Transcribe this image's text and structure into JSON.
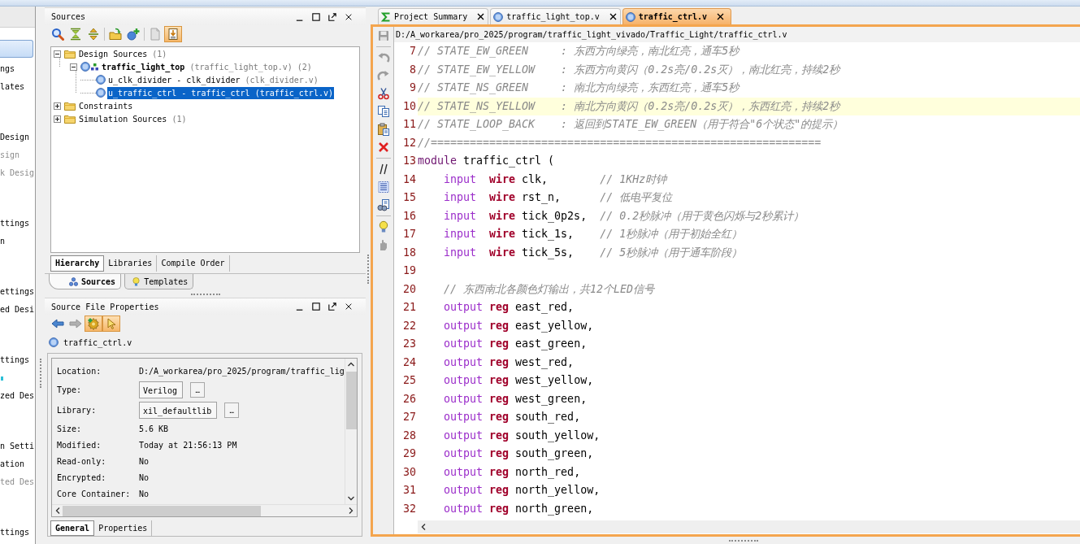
{
  "flow_navigator": {
    "sections": [
      {
        "selected": true,
        "items": [
          {
            "kind": "text",
            "label": "ngs",
            "disabled": false
          },
          {
            "kind": "text",
            "label": "lates",
            "disabled": false
          }
        ]
      },
      {
        "selected": false,
        "items": [
          {
            "kind": "text",
            "label": "Design",
            "disabled": false
          },
          {
            "kind": "text",
            "label": "sign",
            "disabled": true
          },
          {
            "kind": "text",
            "label": "k Desig",
            "disabled": true
          }
        ]
      },
      {
        "selected": false,
        "items": [
          {
            "kind": "text",
            "label": "ttings",
            "disabled": false
          },
          {
            "kind": "text",
            "label": "n",
            "disabled": false
          }
        ]
      },
      {
        "selected": false,
        "items": [
          {
            "kind": "text",
            "label": "ettings",
            "disabled": false
          },
          {
            "kind": "text",
            "label": "ed Desi",
            "disabled": false
          }
        ]
      },
      {
        "selected": false,
        "items": [
          {
            "kind": "text",
            "label": "ttings",
            "disabled": false
          },
          {
            "kind": "icon",
            "disabled": false
          },
          {
            "kind": "text",
            "label": "zed Des",
            "disabled": false
          }
        ]
      },
      {
        "selected": false,
        "items": [
          {
            "kind": "text",
            "label": "n Setti",
            "disabled": false
          },
          {
            "kind": "text",
            "label": "ation",
            "disabled": false
          },
          {
            "kind": "text",
            "label": "ted Des",
            "disabled": true
          }
        ]
      },
      {
        "selected": false,
        "items": [
          {
            "kind": "text",
            "label": "ttings",
            "disabled": false
          }
        ]
      }
    ]
  },
  "sources_panel": {
    "title": "Sources",
    "toolbar": [
      {
        "buttons": [
          {
            "kind": "search",
            "disabled": false,
            "pressed": false
          },
          {
            "kind": "collapse_all",
            "disabled": false,
            "pressed": false
          },
          {
            "kind": "expand_all",
            "disabled": false,
            "pressed": false
          }
        ]
      },
      {
        "buttons": [
          {
            "kind": "add_folder",
            "disabled": false,
            "pressed": false
          },
          {
            "kind": "add_source",
            "disabled": false,
            "pressed": false
          }
        ]
      },
      {
        "buttons": [
          {
            "kind": "help",
            "disabled": true,
            "pressed": false
          },
          {
            "kind": "source_view",
            "disabled": false,
            "pressed": true
          }
        ]
      }
    ],
    "tree": [
      {
        "kind": "folder",
        "label": "Design Sources",
        "detail": "(1)",
        "expanded": true,
        "selected": false,
        "children": [
          {
            "kind": "top_module",
            "label": "traffic_light_top",
            "detail": "(traffic_light_top.v) (2)",
            "expanded": true,
            "selected": false,
            "children": [
              {
                "kind": "instance",
                "label": "u_clk_divider - clk_divider",
                "detail": "(clk_divider.v)",
                "selected": false
              },
              {
                "kind": "instance",
                "label": "u_traffic_ctrl - traffic_ctrl",
                "detail": "(traffic_ctrl.v)",
                "selected": true
              }
            ]
          }
        ]
      },
      {
        "kind": "folder",
        "label": "Constraints",
        "expanded": false,
        "selected": false
      },
      {
        "kind": "folder",
        "label": "Simulation Sources",
        "detail": "(1)",
        "expanded": false,
        "selected": false
      }
    ],
    "view_tabs": [
      {
        "label": "Hierarchy",
        "selected": true
      },
      {
        "label": "Libraries",
        "selected": false
      },
      {
        "label": "Compile Order",
        "selected": false
      }
    ],
    "bottom_tabs": [
      {
        "kind": "sources",
        "label": "Sources",
        "selected": true
      },
      {
        "kind": "templates",
        "label": "Templates",
        "selected": false
      }
    ]
  },
  "properties_panel": {
    "title": "Source File Properties",
    "toolbar": [
      {
        "buttons": [
          {
            "kind": "back",
            "disabled": false,
            "pressed": false
          },
          {
            "kind": "forward",
            "disabled": true,
            "pressed": false
          },
          {
            "kind": "settings",
            "disabled": false,
            "pressed": true
          },
          {
            "kind": "select",
            "disabled": false,
            "pressed": true
          }
        ]
      }
    ],
    "file": "traffic_ctrl.v",
    "rows": [
      {
        "kind": "text",
        "label": "Location:",
        "value": "D:/A_workarea/pro_2025/program/traffic_lig"
      },
      {
        "kind": "field",
        "label": "Type:",
        "value": "Verilog",
        "button": "…"
      },
      {
        "kind": "field",
        "label": "Library:",
        "value": "xil_defaultlib",
        "button": "…"
      },
      {
        "kind": "text",
        "label": "Size:",
        "value": "5.6 KB"
      },
      {
        "kind": "text",
        "label": "Modified:",
        "value": "Today at 21:56:13 PM"
      },
      {
        "kind": "text",
        "label": "Read-only:",
        "value": "No"
      },
      {
        "kind": "text",
        "label": "Encrypted:",
        "value": "No"
      },
      {
        "kind": "text",
        "label": "Core Container:",
        "value": "No"
      }
    ],
    "tabs": [
      {
        "label": "General",
        "selected": true
      },
      {
        "label": "Properties",
        "selected": false
      }
    ]
  },
  "editor": {
    "tabs": [
      {
        "kind": "summary",
        "label": "Project Summary",
        "selected": false
      },
      {
        "kind": "verilog",
        "label": "traffic_light_top.v",
        "selected": false
      },
      {
        "kind": "verilog",
        "label": "traffic_ctrl.v",
        "selected": true
      }
    ],
    "toolbar": [
      {
        "buttons": [
          {
            "kind": "save",
            "disabled": true
          }
        ]
      },
      {
        "buttons": [
          {
            "kind": "undo",
            "disabled": true
          },
          {
            "kind": "redo",
            "disabled": true
          },
          {
            "kind": "cut",
            "disabled": false
          },
          {
            "kind": "copy",
            "disabled": false
          },
          {
            "kind": "paste",
            "disabled": false
          },
          {
            "kind": "delete",
            "disabled": false
          }
        ]
      },
      {
        "buttons": [
          {
            "kind": "comment",
            "disabled": false
          },
          {
            "kind": "indent",
            "disabled": false
          },
          {
            "kind": "find",
            "disabled": false
          }
        ]
      },
      {
        "buttons": [
          {
            "kind": "bulb",
            "disabled": false
          },
          {
            "kind": "clear",
            "disabled": true
          }
        ]
      }
    ],
    "path": "D:/A_workarea/pro_2025/program/traffic_light_vivado/Traffic_Light/traffic_ctrl.v",
    "lines": [
      {
        "number": "7",
        "current": false,
        "kind": "comment",
        "comment": "// STATE_EW_GREEN     : 东西方向绿亮，南北红亮，通车5秒"
      },
      {
        "number": "8",
        "current": false,
        "kind": "comment",
        "comment": "// STATE_EW_YELLOW    : 东西方向黄闪（0.2s亮/0.2s灭），南北红亮，持续2秒"
      },
      {
        "number": "9",
        "current": false,
        "kind": "comment",
        "comment": "// STATE_NS_GREEN     : 南北方向绿亮，东西红亮，通车5秒"
      },
      {
        "number": "10",
        "current": true,
        "kind": "comment",
        "comment": "// STATE_NS_YELLOW    : 南北方向黄闪（0.2s亮/0.2s灭），东西红亮，持续2秒"
      },
      {
        "number": "11",
        "current": false,
        "kind": "comment",
        "comment": "// STATE_LOOP_BACK    : 返回到STATE_EW_GREEN（用于符合\"6个状态\"的提示）"
      },
      {
        "number": "12",
        "current": false,
        "kind": "comment",
        "comment": "//============================================================"
      },
      {
        "number": "13",
        "current": false,
        "kind": "module",
        "keyword": "module",
        "name": "traffic_ctrl ("
      },
      {
        "number": "14",
        "current": false,
        "kind": "port",
        "direction": "input",
        "type": "wire",
        "name": "clk,",
        "comment": "// 1KHz时钟"
      },
      {
        "number": "15",
        "current": false,
        "kind": "port",
        "direction": "input",
        "type": "wire",
        "name": "rst_n,",
        "comment": "// 低电平复位"
      },
      {
        "number": "16",
        "current": false,
        "kind": "port",
        "direction": "input",
        "type": "wire",
        "name": "tick_0p2s,",
        "comment": "// 0.2秒脉冲（用于黄色闪烁与2秒累计）"
      },
      {
        "number": "17",
        "current": false,
        "kind": "port",
        "direction": "input",
        "type": "wire",
        "name": "tick_1s,",
        "comment": "// 1秒脉冲（用于初始全红）"
      },
      {
        "number": "18",
        "current": false,
        "kind": "port",
        "direction": "input",
        "type": "wire",
        "name": "tick_5s,",
        "comment": "// 5秒脉冲（用于通车阶段）"
      },
      {
        "number": "19",
        "current": false,
        "kind": "blank"
      },
      {
        "number": "20",
        "current": false,
        "kind": "indented_comment",
        "comment": "// 东西南北各颜色灯输出，共12个LED信号"
      },
      {
        "number": "21",
        "current": false,
        "kind": "port",
        "direction": "output",
        "type": "reg",
        "name": "east_red,"
      },
      {
        "number": "22",
        "current": false,
        "kind": "port",
        "direction": "output",
        "type": "reg",
        "name": "east_yellow,"
      },
      {
        "number": "23",
        "current": false,
        "kind": "port",
        "direction": "output",
        "type": "reg",
        "name": "east_green,"
      },
      {
        "number": "24",
        "current": false,
        "kind": "port",
        "direction": "output",
        "type": "reg",
        "name": "west_red,"
      },
      {
        "number": "25",
        "current": false,
        "kind": "port",
        "direction": "output",
        "type": "reg",
        "name": "west_yellow,"
      },
      {
        "number": "26",
        "current": false,
        "kind": "port",
        "direction": "output",
        "type": "reg",
        "name": "west_green,"
      },
      {
        "number": "27",
        "current": false,
        "kind": "port",
        "direction": "output",
        "type": "reg",
        "name": "south_red,"
      },
      {
        "number": "28",
        "current": false,
        "kind": "port",
        "direction": "output",
        "type": "reg",
        "name": "south_yellow,"
      },
      {
        "number": "29",
        "current": false,
        "kind": "port",
        "direction": "output",
        "type": "reg",
        "name": "south_green,"
      },
      {
        "number": "30",
        "current": false,
        "kind": "port",
        "direction": "output",
        "type": "reg",
        "name": "north_red,"
      },
      {
        "number": "31",
        "current": false,
        "kind": "port",
        "direction": "output",
        "type": "reg",
        "name": "north_yellow,"
      },
      {
        "number": "32",
        "current": false,
        "kind": "port",
        "direction": "output",
        "type": "reg",
        "name": "north_green,"
      }
    ]
  }
}
